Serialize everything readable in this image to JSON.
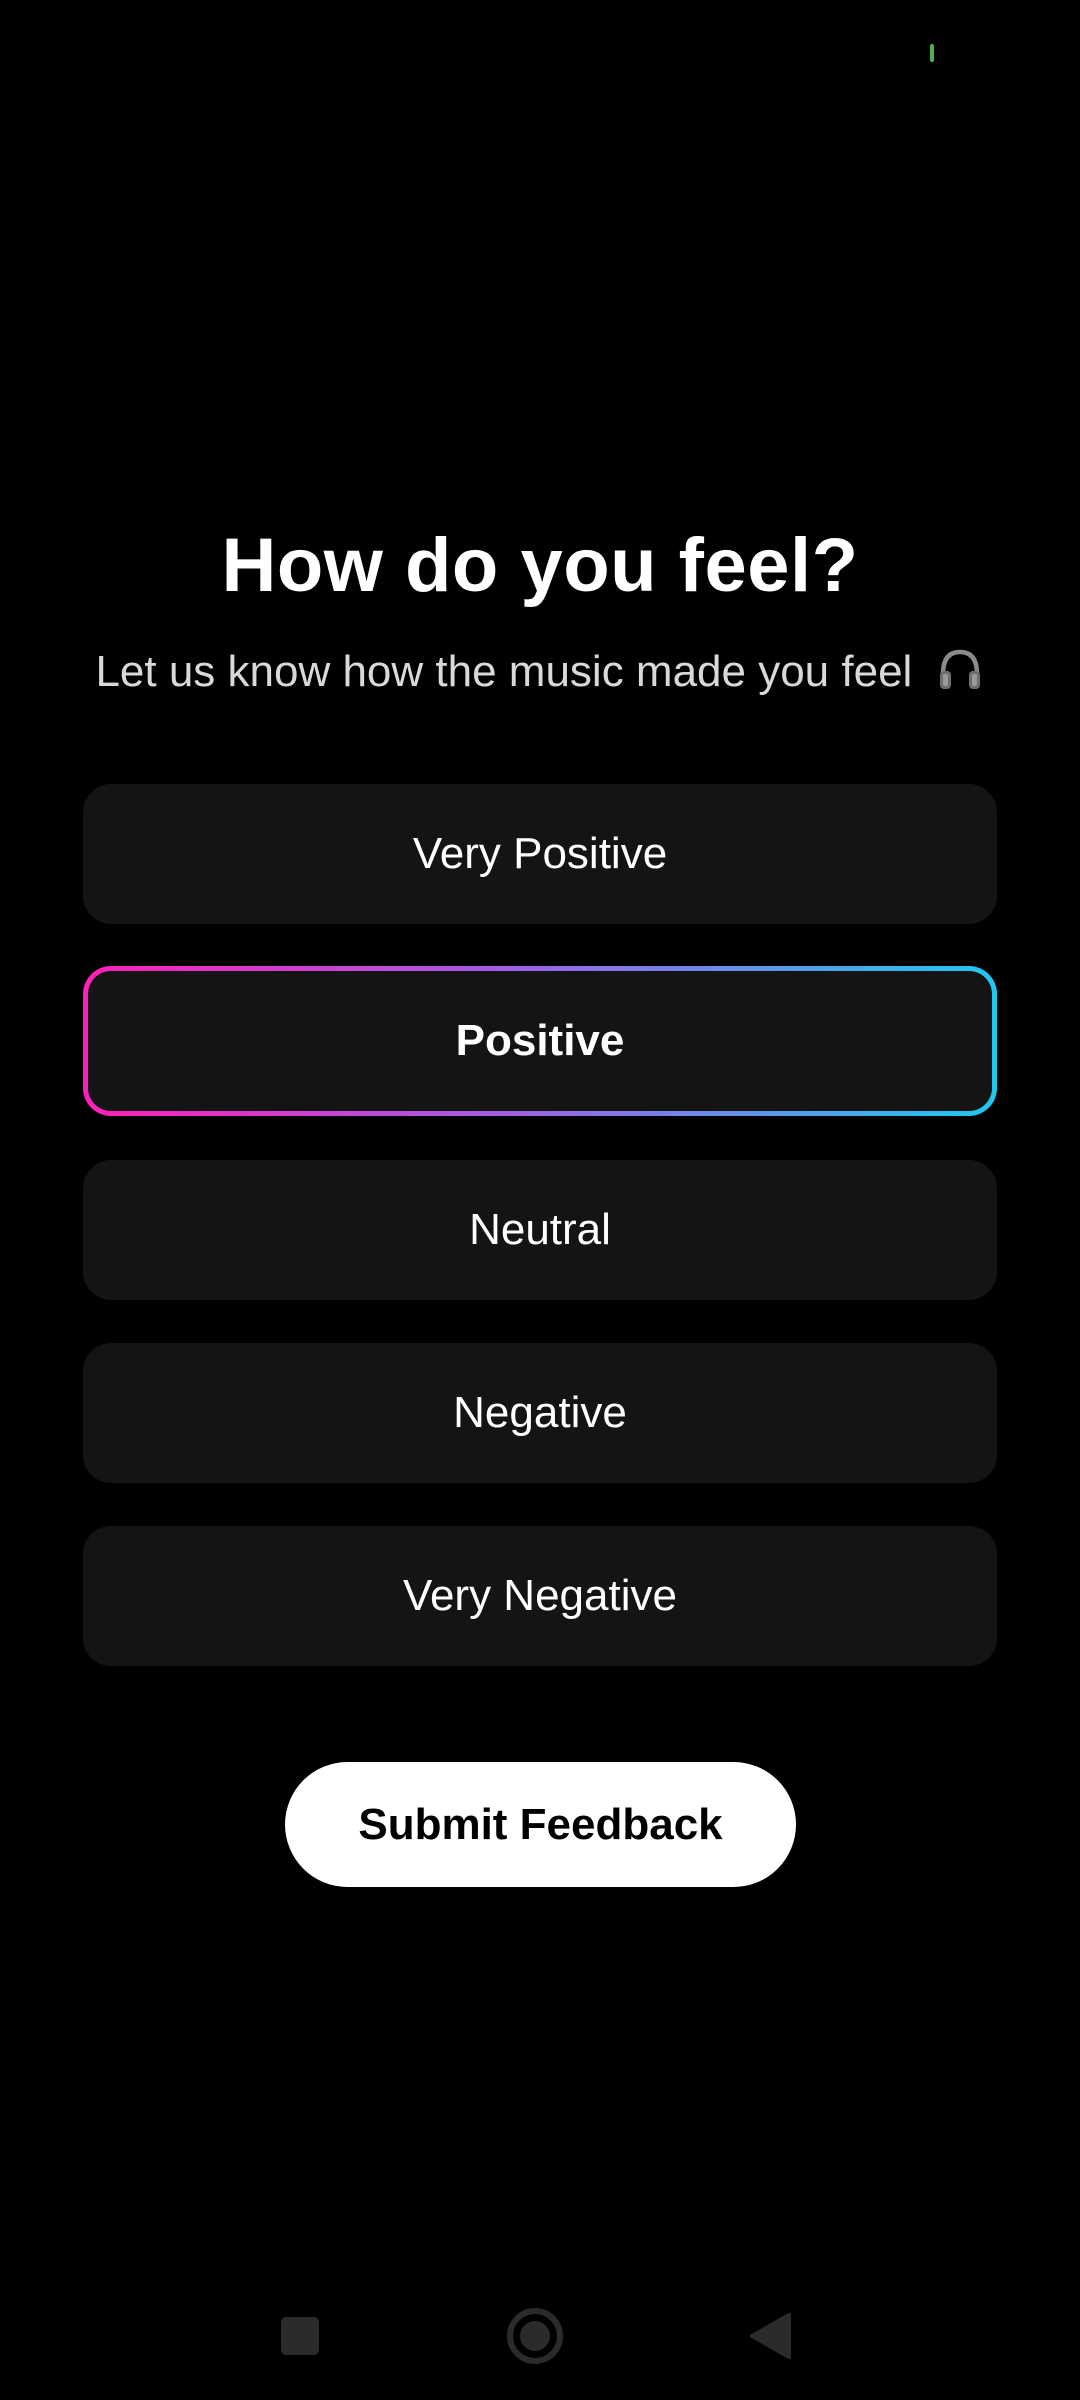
{
  "status_bar": {
    "indicator_color": "#4caf50"
  },
  "header": {
    "title": "How do you feel?",
    "subtitle": "Let us know how the music made you feel",
    "subtitle_icon": "headphones-icon"
  },
  "options": [
    {
      "label": "Very Positive",
      "selected": false
    },
    {
      "label": "Positive",
      "selected": true
    },
    {
      "label": "Neutral",
      "selected": false
    },
    {
      "label": "Negative",
      "selected": false
    },
    {
      "label": "Very Negative",
      "selected": false
    }
  ],
  "submit": {
    "label": "Submit Feedback"
  },
  "nav_bar": {
    "recents_icon": "square-icon",
    "home_icon": "circle-icon",
    "back_icon": "triangle-back-icon"
  },
  "colors": {
    "background": "#000000",
    "option_background": "#141414",
    "selected_gradient_start": "#ff1fb8",
    "selected_gradient_mid": "#a45ce6",
    "selected_gradient_end": "#1fc8ef",
    "button_background": "#ffffff",
    "nav_icon": "#2b2b2b"
  }
}
